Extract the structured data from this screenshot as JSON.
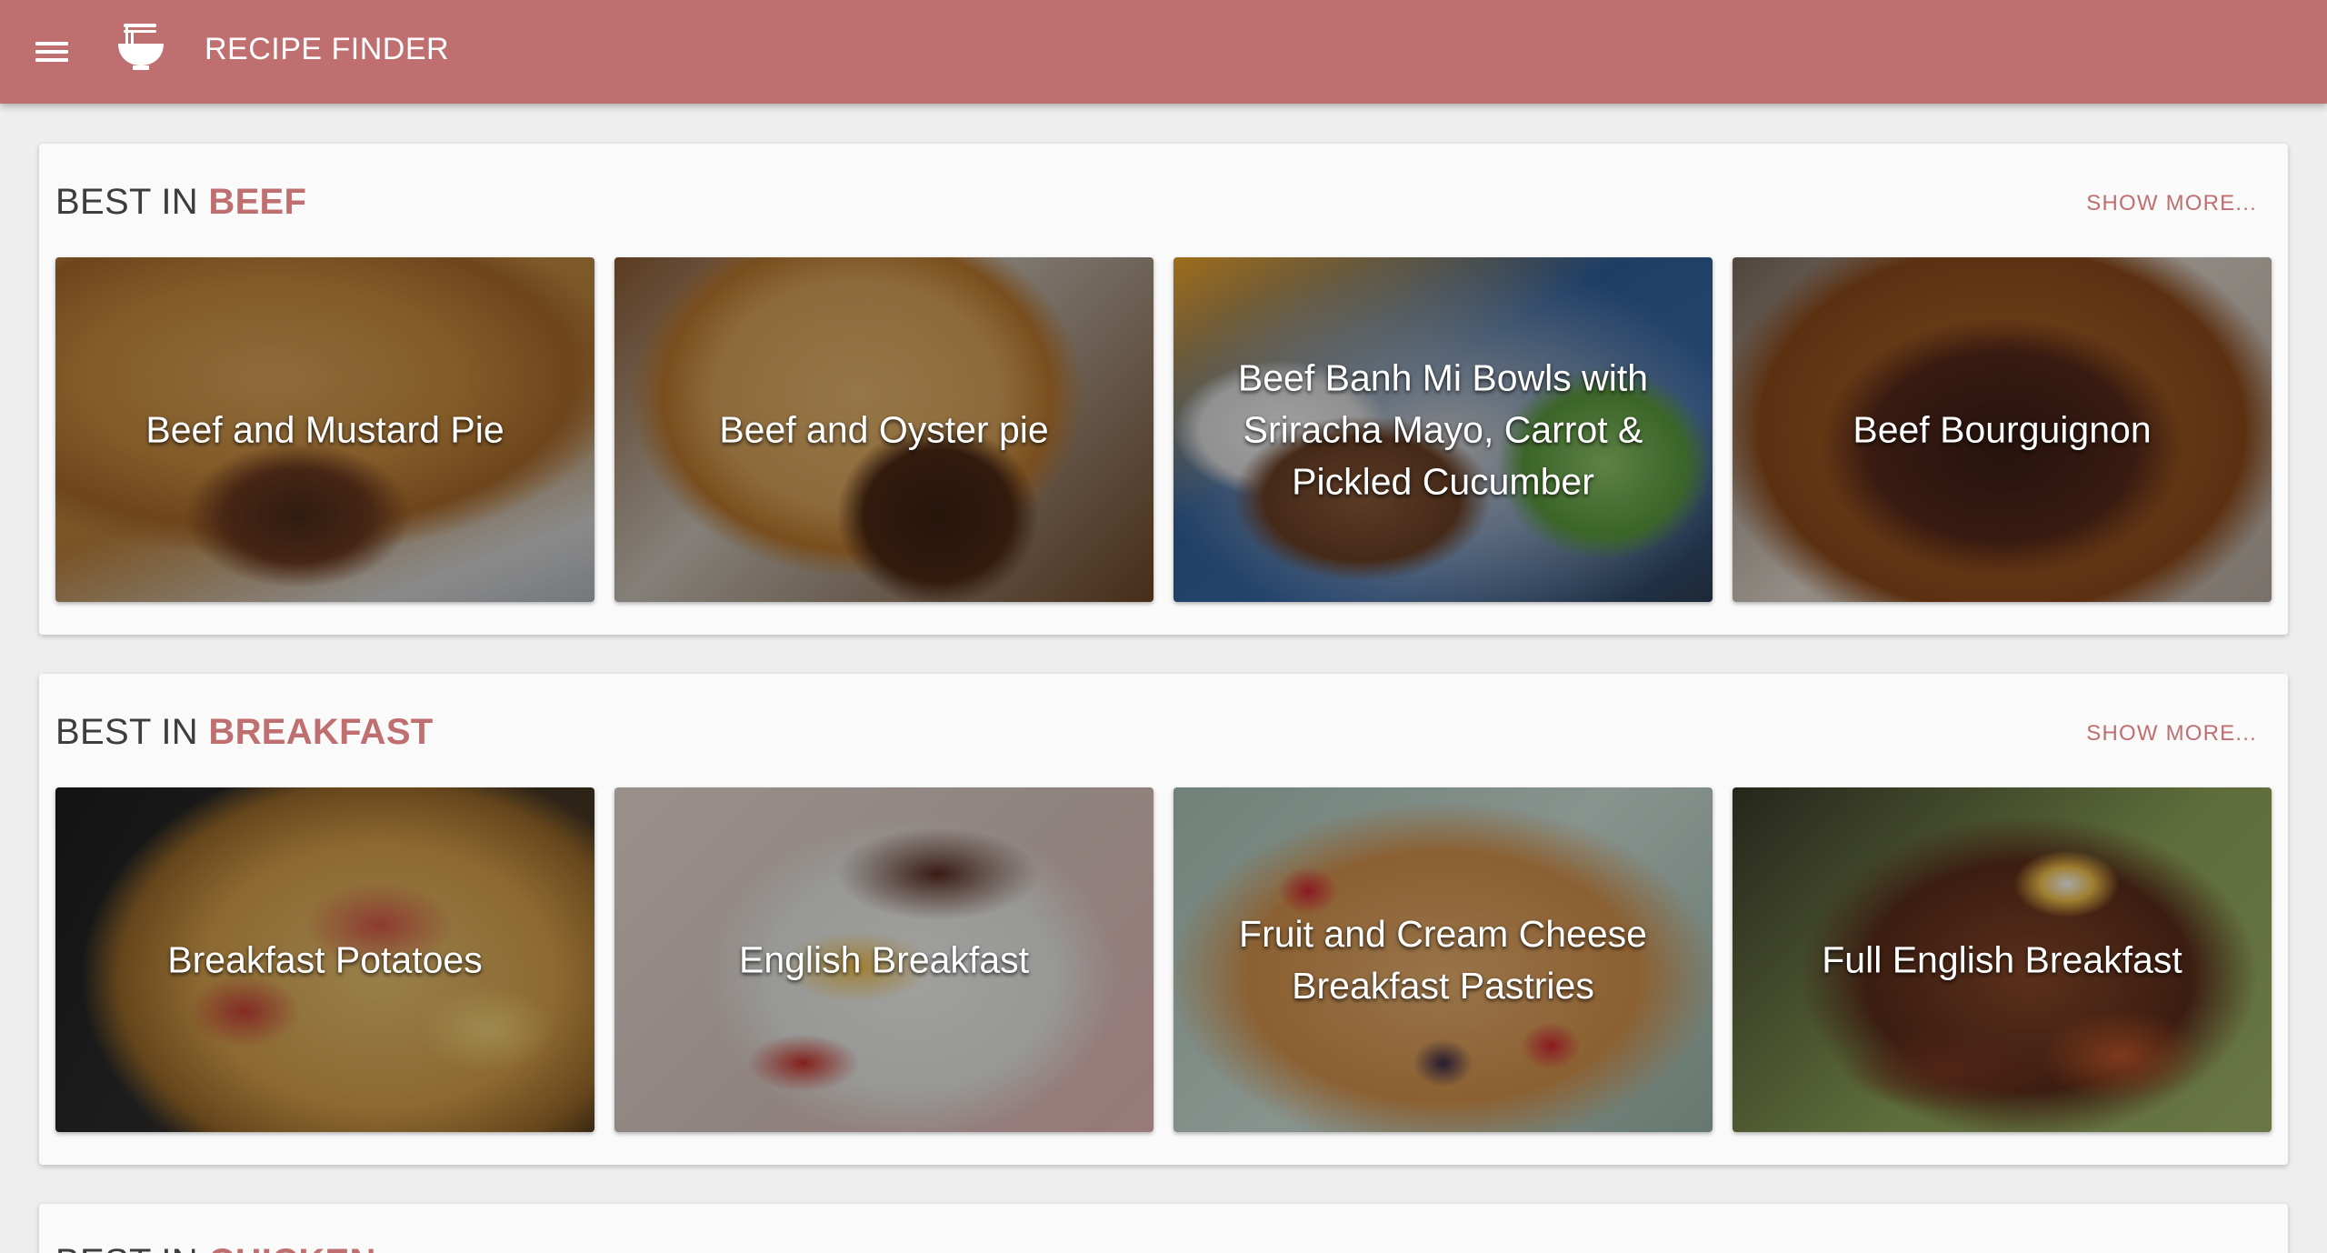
{
  "colors": {
    "primary": "#c06f70",
    "background": "#eeeeee",
    "surface": "#fafafa"
  },
  "appbar": {
    "title": "RECIPE FINDER",
    "menu_icon": "hamburger-menu-icon",
    "logo_icon": "noodle-bowl-icon"
  },
  "sections": [
    {
      "prefix": "BEST IN ",
      "category": "BEEF",
      "show_more": "SHOW MORE...",
      "recipes": [
        {
          "title": "Beef and Mustard Pie"
        },
        {
          "title": "Beef and Oyster pie"
        },
        {
          "title": "Beef Banh Mi Bowls with Sriracha Mayo, Carrot & Pickled Cucumber"
        },
        {
          "title": "Beef Bourguignon"
        }
      ]
    },
    {
      "prefix": "BEST IN ",
      "category": "BREAKFAST",
      "show_more": "SHOW MORE...",
      "recipes": [
        {
          "title": "Breakfast Potatoes"
        },
        {
          "title": "English Breakfast"
        },
        {
          "title": "Fruit and Cream Cheese Breakfast Pastries"
        },
        {
          "title": "Full English Breakfast"
        }
      ]
    },
    {
      "prefix": "BEST IN ",
      "category": "CHICKEN"
    }
  ]
}
